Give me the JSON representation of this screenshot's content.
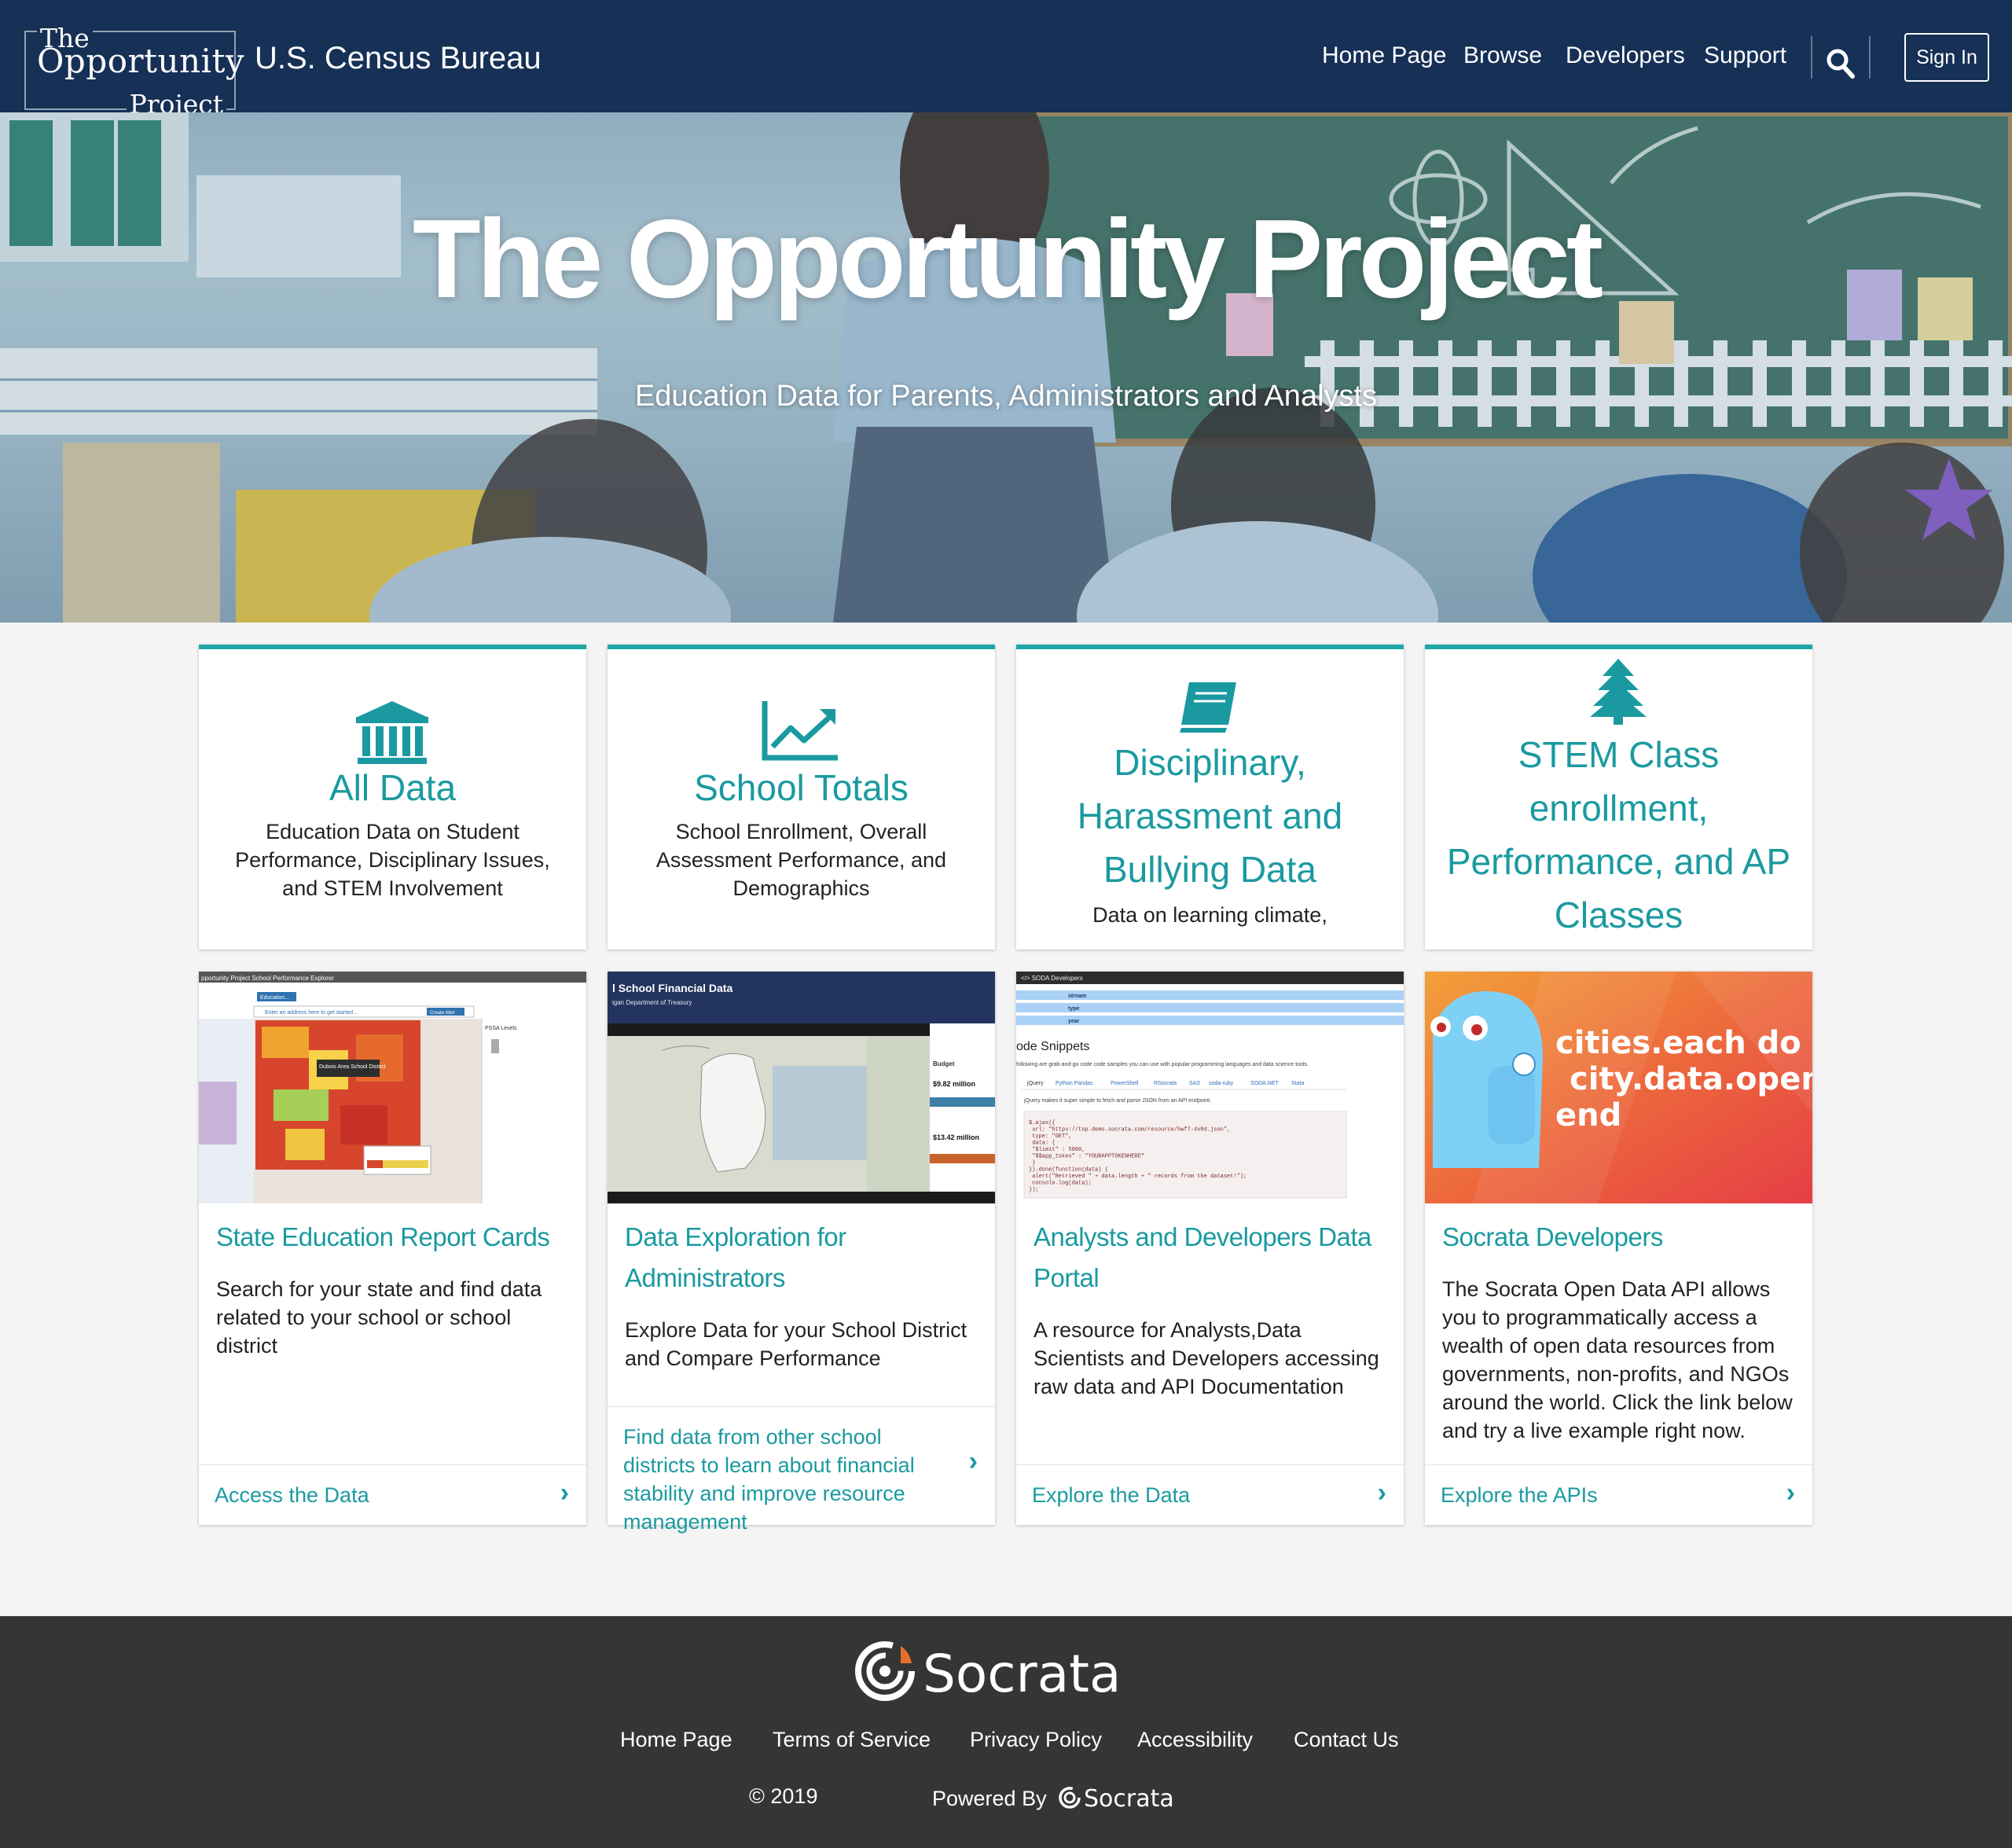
{
  "header": {
    "logo_line1": "The",
    "logo_line2": "Opportunity",
    "logo_line3": "Project",
    "org_name": "U.S. Census Bureau",
    "nav": [
      "Home Page",
      "Browse",
      "Developers",
      "Support"
    ],
    "search_icon": "search-icon",
    "sign_in": "Sign In"
  },
  "hero": {
    "title": "The Opportunity Project",
    "subtitle": "Education Data for Parents, Administrators and Analysts"
  },
  "categories": [
    {
      "icon": "institution-icon",
      "title": "All Data",
      "description": "Education Data on Student Performance, Disciplinary Issues, and STEM Involvement"
    },
    {
      "icon": "line-chart-icon",
      "title": "School Totals",
      "description": "School Enrollment, Overall Assessment Performance, and Demographics"
    },
    {
      "icon": "book-icon",
      "title": "Disciplinary, Harassment and Bullying Data",
      "description": "Data on learning climate,"
    },
    {
      "icon": "tree-icon",
      "title": "STEM Class enrollment, Performance, and AP Classes",
      "description": ""
    }
  ],
  "features": [
    {
      "title": "State Education Report Cards",
      "description": "Search for your state and find data related to your school or school district",
      "link": "Access the Data",
      "image_text": {
        "top": "pportunity Project School Performance Explorer",
        "tab": "Education...",
        "search": "Enter an address here to get started...",
        "button": "Create Alert",
        "district": "Dubois Area School District",
        "legend": "PSSA Levels"
      }
    },
    {
      "title": "Data Exploration for Administrators",
      "description": "Explore Data for your School District and Compare Performance",
      "link": "Find data from other school districts to learn about financial stability and improve resource management",
      "image_text": {
        "title": "l School Financial Data",
        "subtitle": "igan Department of Treasury",
        "budget": "Budget",
        "amount1": "$9.82 million",
        "amount2": "$13.42 million"
      }
    },
    {
      "title": "Analysts and Developers Data Portal",
      "description": "A resource for Analysts,Data Scientists and Developers accessing raw data and API Documentation",
      "link": "Explore the Data",
      "image_text": {
        "nav": "</> SODA Developers",
        "rows": [
          "strnam",
          "type",
          "year"
        ],
        "heading": "ode Snippets",
        "intro": "following are grab-and-go code code samples you can use with popular programming languages and data science tools.",
        "tabs": [
          "jQuery",
          "Python Pandas",
          "PowerShell",
          "RSocrata",
          "SAS",
          "soda-ruby",
          "SODA.NET",
          "Stata"
        ],
        "note": "jQuery makes it super simple to fetch and parse JSON from an API endpoint.",
        "code": "$.ajax({\n  url: \"https://top.demo.socrata.com/resource/hwf7-4v8d.json\",\n  type: \"GET\",\n  data: {\n    \"$limit\" : 5000,\n    \"$$app_token\" : \"YOURAPPTOKENHERE\"\n  }\n}).done(function(data) {\n  alert(\"Retrieved \" + data.length + \" records from the dataset!\");\n  console.log(data);\n});"
      }
    },
    {
      "title": "Socrata Developers",
      "description": "The Socrata Open Data API allows you to programmatically access a wealth of open data resources from governments, non-profits, and NGOs around the world. Click the link below and try a live example right now.",
      "link": "Explore the APIs",
      "image_text": {
        "line1": "cities.each do |ci",
        "line2": "city.data.open()",
        "line3": "end"
      }
    }
  ],
  "footer": {
    "brand": "Socrata",
    "links": [
      "Home Page",
      "Terms of Service",
      "Privacy Policy",
      "Accessibility",
      "Contact Us"
    ],
    "copyright": "© 2019",
    "powered_by": "Powered By",
    "powered_brand": "Socrata"
  },
  "colors": {
    "header_bg": "#163056",
    "accent": "#1ea7a7",
    "footer_bg": "#353535"
  }
}
